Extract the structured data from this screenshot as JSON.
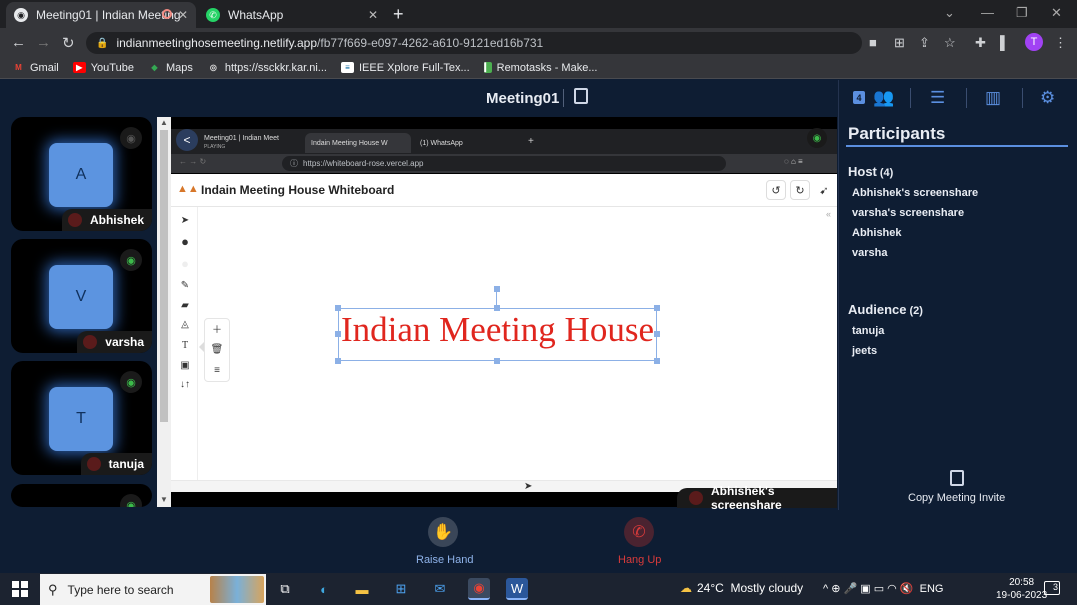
{
  "browser": {
    "tabs": [
      {
        "title": "Meeting01 | Indian Meeting",
        "active": true
      },
      {
        "title": "WhatsApp",
        "active": false
      }
    ],
    "url_host": "indianmeetinghosemeeting.netlify.app",
    "url_path": "/fb77f669-e097-4262-a610-9121ed16b731",
    "profile_initial": "T",
    "bookmarks": [
      "Gmail",
      "YouTube",
      "Maps",
      "https://ssckkr.kar.ni...",
      "IEEE Xplore Full-Tex...",
      "Remotasks - Make..."
    ]
  },
  "meeting": {
    "title": "Meeting01",
    "tiles": [
      {
        "initial": "A",
        "name": "Abhishek"
      },
      {
        "initial": "V",
        "name": "varsha"
      },
      {
        "initial": "T",
        "name": "tanuja"
      }
    ],
    "share_label": "Abhishek's screenshare"
  },
  "shared_screen": {
    "tabs": [
      "Meeting01 | Indian Meet",
      "PLAYING",
      "Indain Meeting House W",
      "(1) WhatsApp"
    ],
    "url": "https://whiteboard-rose.vercel.app",
    "app_title": "Indain Meeting House Whiteboard",
    "canvas_text": "Indian Meeting House"
  },
  "sidebar": {
    "participants_badge": "4",
    "title": "Participants",
    "host_label": "Host",
    "host_count": "(4)",
    "hosts": [
      "Abhishek's screenshare",
      "varsha's screenshare",
      "Abhishek",
      "varsha"
    ],
    "audience_label": "Audience",
    "audience_count": "(2)",
    "audience": [
      "tanuja",
      "jeets"
    ],
    "invite_label": "Copy Meeting Invite"
  },
  "controls": {
    "raise_hand": "Raise Hand",
    "hang_up": "Hang Up"
  },
  "taskbar": {
    "search_placeholder": "Type here to search",
    "temperature": "24°C",
    "weather": "Mostly cloudy",
    "language": "ENG",
    "time": "20:58",
    "date": "19-06-2023",
    "notifications": "3"
  },
  "colors": {
    "accent": "#5b8fe0",
    "canvas_text": "#e0261e",
    "hangup": "#d83b3b"
  }
}
